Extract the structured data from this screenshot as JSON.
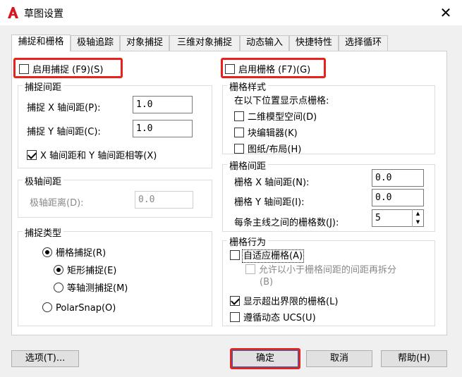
{
  "window": {
    "title": "草图设置",
    "logo_icon": "autocad-a-logo",
    "close_glyph": "✕"
  },
  "tabs": [
    {
      "label": "捕捉和栅格",
      "active": true
    },
    {
      "label": "极轴追踪",
      "active": false
    },
    {
      "label": "对象捕捉",
      "active": false
    },
    {
      "label": "三维对象捕捉",
      "active": false
    },
    {
      "label": "动态输入",
      "active": false
    },
    {
      "label": "快捷特性",
      "active": false
    },
    {
      "label": "选择循环",
      "active": false
    }
  ],
  "snap": {
    "enable_label": "启用捕捉 (F9)(S)",
    "enable_checked": false,
    "spacing_title": "捕捉间距",
    "x_label": "捕捉 X 轴间距(P):",
    "x_value": "1.0",
    "y_label": "捕捉 Y 轴间距(C):",
    "y_value": "1.0",
    "equal_label": "X 轴间距和 Y 轴间距相等(X)",
    "equal_checked": true
  },
  "polar": {
    "title": "极轴间距",
    "distance_label": "极轴距离(D):",
    "distance_value": "0.0"
  },
  "snap_type": {
    "title": "捕捉类型",
    "grid_snap_label": "栅格捕捉(R)",
    "rect_snap_label": "矩形捕捉(E)",
    "iso_snap_label": "等轴测捕捉(M)",
    "polar_snap_label": "PolarSnap(O)",
    "selected": "grid",
    "grid_sub_selected": "rect"
  },
  "grid": {
    "enable_label": "启用栅格 (F7)(G)",
    "enable_checked": false,
    "style_title": "栅格样式",
    "style_desc": "在以下位置显示点栅格:",
    "model_space_label": "二维模型空间(D)",
    "block_editor_label": "块编辑器(K)",
    "sheet_layout_label": "图纸/布局(H)",
    "spacing_title": "栅格间距",
    "x_label": "栅格 X 轴间距(N):",
    "x_value": "0.0",
    "y_label": "栅格 Y 轴间距(I):",
    "y_value": "0.0",
    "major_label": "每条主线之间的栅格数(J):",
    "major_value": "5",
    "behavior_title": "栅格行为",
    "adaptive_label": "自适应栅格(A)",
    "adaptive_checked": false,
    "subdivision_label_line1": "允许以小于栅格间距的间距再拆分",
    "subdivision_label_line2": "(B)",
    "beyond_limits_label": "显示超出界限的栅格(L)",
    "beyond_limits_checked": true,
    "follow_ucs_label": "遵循动态 UCS(U)",
    "follow_ucs_checked": false
  },
  "buttons": {
    "options": "选项(T)...",
    "ok": "确定",
    "cancel": "取消",
    "help": "帮助(H)"
  },
  "colors": {
    "highlight_red": "#e8211b",
    "logo_red": "#d6181e"
  }
}
